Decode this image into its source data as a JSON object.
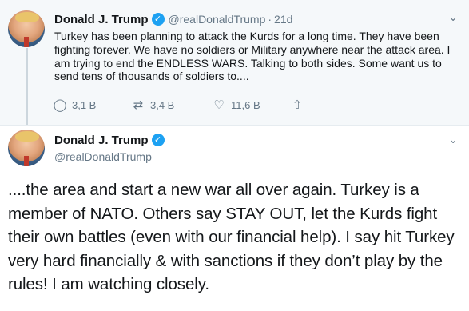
{
  "colors": {
    "accent": "#1da1f2",
    "muted": "#657786",
    "text": "#14171a",
    "thread_bg": "#f5f8fa"
  },
  "icons": [
    "verified-badge-icon",
    "chevron-down-icon",
    "reply-icon",
    "retweet-icon",
    "like-icon",
    "share-icon"
  ],
  "tweet1": {
    "author_name": "Donald J. Trump",
    "verified_mark": "✓",
    "handle": "@realDonaldTrump",
    "separator": "·",
    "time": "21d",
    "menu_glyph": "⌄",
    "text": "Turkey has been planning to attack the Kurds for a long time. They have been fighting forever. We have no soldiers or Military anywhere near the attack area. I am trying to end the ENDLESS WARS. Talking to both sides. Some want us to send tens of thousands of soldiers to....",
    "reply_count": "3,1 B",
    "retweet_count": "3,4 B",
    "like_count": "11,6 B",
    "reply_glyph": "◯",
    "retweet_glyph": "⇄",
    "like_glyph": "♡",
    "share_glyph": "⇧"
  },
  "tweet2": {
    "author_name": "Donald J. Trump",
    "verified_mark": "✓",
    "handle": "@realDonaldTrump",
    "menu_glyph": "⌄",
    "text": "....the area and start a new war all over again. Turkey is a member of NATO. Others say STAY OUT, let the Kurds fight their own battles (even with our financial help). I say hit Turkey very hard financially & with sanctions if they don’t play by the rules! I am watching closely."
  }
}
